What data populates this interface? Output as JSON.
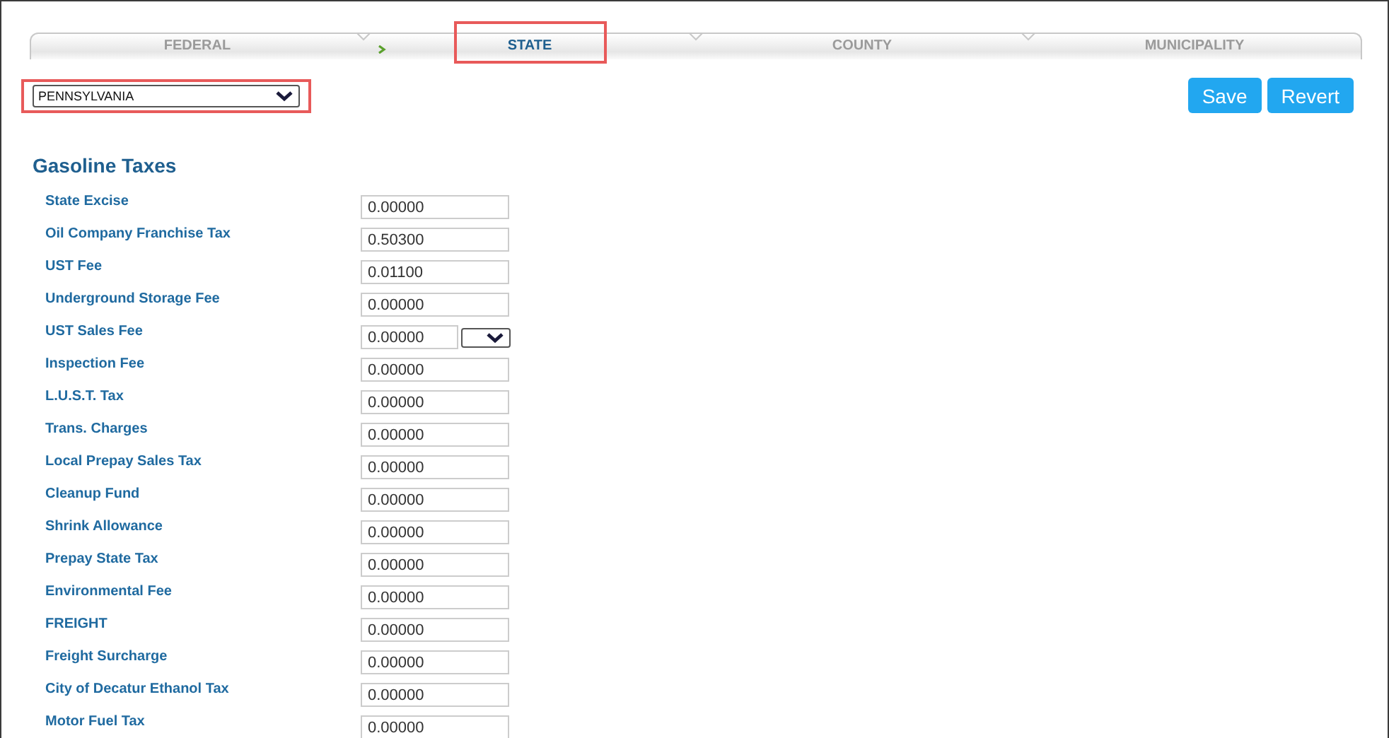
{
  "tabs": [
    {
      "label": "FEDERAL",
      "selected": false,
      "done": true,
      "highlighted": false
    },
    {
      "label": "STATE",
      "selected": true,
      "done": false,
      "highlighted": true
    },
    {
      "label": "COUNTY",
      "selected": false,
      "done": false,
      "highlighted": false
    },
    {
      "label": "MUNICIPALITY",
      "selected": false,
      "done": false,
      "highlighted": false
    }
  ],
  "state_select": {
    "value": "PENNSYLVANIA",
    "highlighted": true
  },
  "buttons": [
    "Save",
    "Revert"
  ],
  "section_title": "Gasoline Taxes",
  "rows": [
    {
      "label": "State Excise",
      "value": "0.00000",
      "kind": "plain"
    },
    {
      "label": "Oil Company Franchise Tax",
      "value": "0.50300",
      "kind": "plain"
    },
    {
      "label": "UST Fee",
      "value": "0.01100",
      "kind": "plain"
    },
    {
      "label": "Underground Storage Fee",
      "value": "0.00000",
      "kind": "plain"
    },
    {
      "label": "UST Sales Fee",
      "value": "0.00000",
      "kind": "unit"
    },
    {
      "label": "Inspection Fee",
      "value": "0.00000",
      "kind": "plain"
    },
    {
      "label": "L.U.S.T. Tax",
      "value": "0.00000",
      "kind": "plain"
    },
    {
      "label": "Trans. Charges",
      "value": "0.00000",
      "kind": "plain"
    },
    {
      "label": "Local Prepay Sales Tax",
      "value": "0.00000",
      "kind": "plain"
    },
    {
      "label": "Cleanup Fund",
      "value": "0.00000",
      "kind": "plain"
    },
    {
      "label": "Shrink Allowance",
      "value": "0.00000",
      "kind": "plain"
    },
    {
      "label": "Prepay State Tax",
      "value": "0.00000",
      "kind": "plain"
    },
    {
      "label": "Environmental Fee",
      "value": "0.00000",
      "kind": "plain"
    },
    {
      "label": "FREIGHT",
      "value": "0.00000",
      "kind": "plain"
    },
    {
      "label": "Freight Surcharge",
      "value": "0.00000",
      "kind": "plain"
    },
    {
      "label": "City of Decatur Ethanol Tax",
      "value": "0.00000",
      "kind": "plain"
    },
    {
      "label": "Motor Fuel Tax",
      "value": "0.00000",
      "kind": "plain"
    }
  ]
}
